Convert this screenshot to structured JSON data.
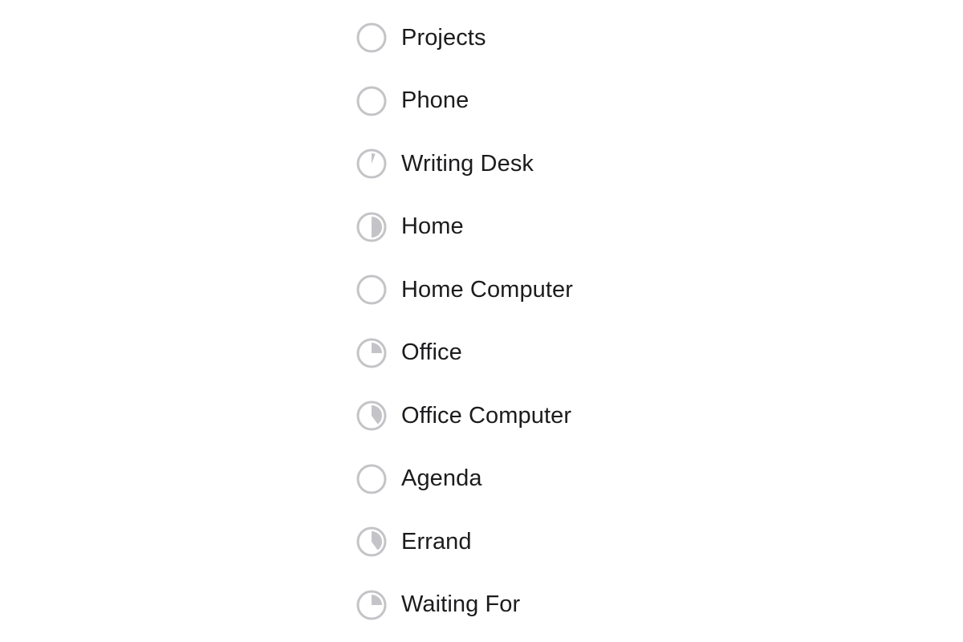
{
  "list": {
    "ring_color": "#c4c4c8",
    "fill_color": "#c4c4c8",
    "items": [
      {
        "label": "Projects",
        "progress": 0
      },
      {
        "label": "Phone",
        "progress": 0
      },
      {
        "label": "Writing Desk",
        "progress": 0.06
      },
      {
        "label": "Home",
        "progress": 0.5
      },
      {
        "label": "Home Computer",
        "progress": 0
      },
      {
        "label": "Office",
        "progress": 0.25
      },
      {
        "label": "Office Computer",
        "progress": 0.4
      },
      {
        "label": "Agenda",
        "progress": 0
      },
      {
        "label": "Errand",
        "progress": 0.4
      },
      {
        "label": "Waiting For",
        "progress": 0.25
      }
    ]
  }
}
